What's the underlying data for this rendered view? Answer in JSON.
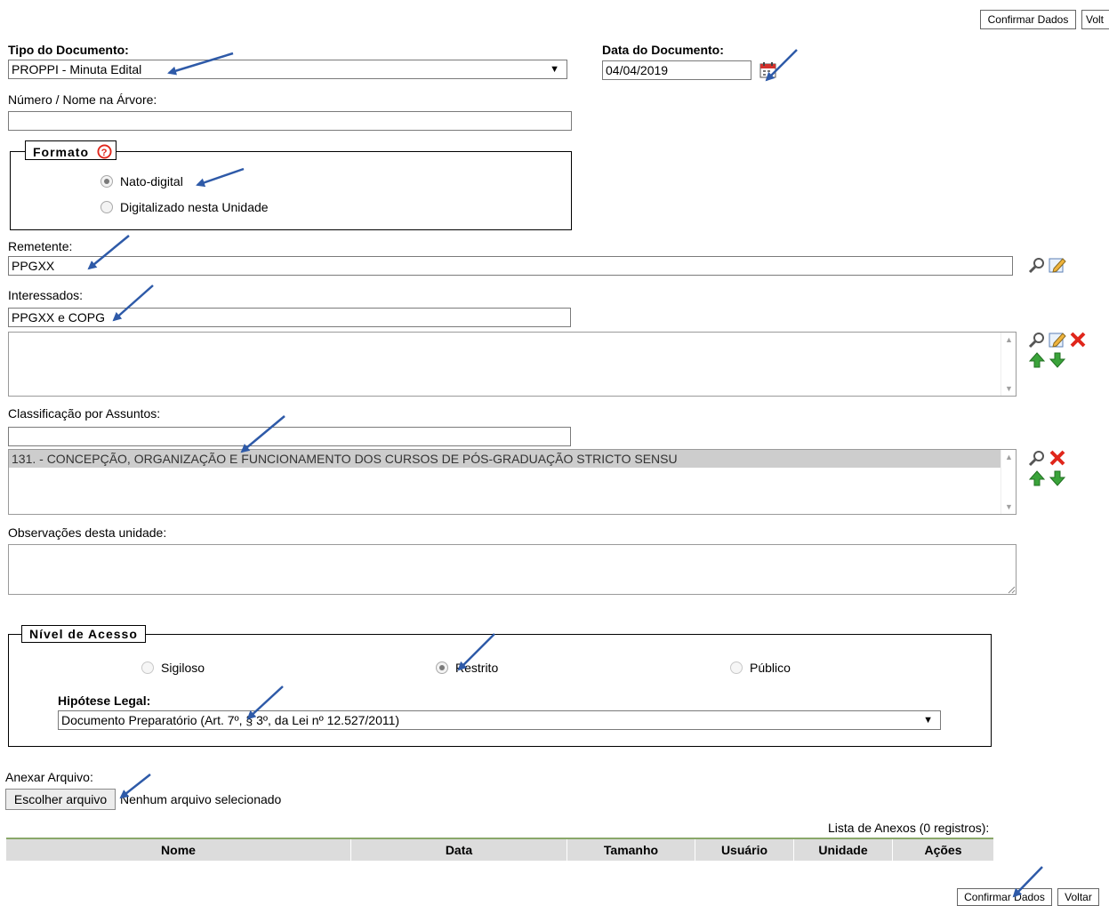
{
  "top_buttons": {
    "confirm": "Confirmar Dados",
    "back": "Volt"
  },
  "bottom_buttons": {
    "confirm": "Confirmar Dados",
    "back": "Voltar"
  },
  "tipo_documento": {
    "label": "Tipo do Documento:",
    "value": "PROPPI - Minuta Edital"
  },
  "data_documento": {
    "label": "Data do Documento:",
    "value": "04/04/2019"
  },
  "numero_nome": {
    "label": "Número / Nome na Árvore:",
    "value": ""
  },
  "formato": {
    "legend": "Formato",
    "options": [
      {
        "label": "Nato-digital",
        "checked": true
      },
      {
        "label": "Digitalizado nesta Unidade",
        "checked": false
      }
    ]
  },
  "remetente": {
    "label": "Remetente:",
    "value": "PPGXX"
  },
  "interessados": {
    "label": "Interessados:",
    "value": "PPGXX e COPG"
  },
  "classificacao": {
    "label": "Classificação por Assuntos:",
    "input_value": "",
    "items": [
      "131. - CONCEPÇÃO, ORGANIZAÇÃO E FUNCIONAMENTO DOS CURSOS DE PÓS-GRADUAÇÃO STRICTO SENSU"
    ]
  },
  "observacoes": {
    "label": "Observações desta unidade:",
    "value": ""
  },
  "nivel_acesso": {
    "legend": "Nível de Acesso",
    "options": [
      {
        "label": "Sigiloso",
        "checked": false
      },
      {
        "label": "Restrito",
        "checked": true
      },
      {
        "label": "Público",
        "checked": false
      }
    ],
    "hipotese_label": "Hipótese Legal:",
    "hipotese_value": "Documento Preparatório (Art. 7º, § 3º, da Lei nº 12.527/2011)"
  },
  "anexar": {
    "label": "Anexar Arquivo:",
    "button": "Escolher arquivo",
    "status": "Nenhum arquivo selecionado"
  },
  "anexos_table": {
    "caption": "Lista de Anexos (0 registros):",
    "columns": [
      "Nome",
      "Data",
      "Tamanho",
      "Usuário",
      "Unidade",
      "Ações"
    ]
  },
  "colors": {
    "arrow": "#2e5aa8",
    "table_header": "#dcdcdc",
    "table_border": "#8aa86a",
    "delete": "#e0261b",
    "move": "#3aa33a"
  },
  "icons": [
    "calendar-icon",
    "help-icon",
    "search-icon",
    "edit-icon",
    "delete-icon",
    "move-up-icon",
    "move-down-icon"
  ]
}
